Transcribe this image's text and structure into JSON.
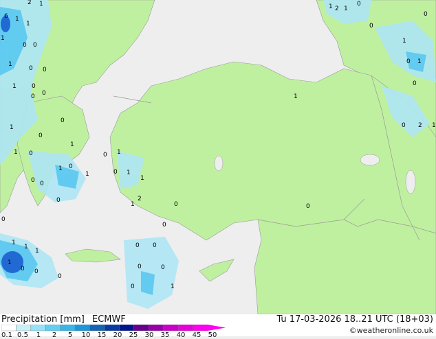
{
  "header": {
    "title": "Precipitation [mm]",
    "model": "ECMWF",
    "datetime": "Tu 17-03-2026 18..21 UTC (18+03)",
    "credit": "©weatheronline.co.uk"
  },
  "legend": {
    "ticks": [
      "0.1",
      "0.5",
      "1",
      "2",
      "5",
      "10",
      "15",
      "20",
      "25",
      "30",
      "35",
      "40",
      "45",
      "50"
    ],
    "colors": [
      "#ffffff",
      "#c8f0f8",
      "#96e1f5",
      "#64cdf0",
      "#3cb4e6",
      "#1e96d7",
      "#1464b4",
      "#0a3ca0",
      "#00148c",
      "#64008c",
      "#9600aa",
      "#c800c8",
      "#e600dc",
      "#ff00f0"
    ]
  },
  "colors": {
    "land": "#bff0a0",
    "sea": "#eeeeee",
    "border": "#888888",
    "precip_light": "#aee6f5",
    "precip_mid": "#5ac8f0",
    "precip_heavy": "#1e64d2"
  },
  "map_labels": [
    "2",
    "1",
    "1",
    "0",
    "2",
    "1",
    "6",
    "1",
    "0",
    "1",
    "1",
    "0",
    "0",
    "0",
    "1",
    "1",
    "0",
    "0",
    "1",
    "0",
    "0",
    "1",
    "0",
    "0",
    "0",
    "0",
    "1",
    "0",
    "2",
    "1",
    "0",
    "1",
    "1",
    "1",
    "0",
    "0",
    "1",
    "1",
    "0",
    "0",
    "0",
    "1",
    "0",
    "1",
    "1",
    "0",
    "2",
    "1",
    "0",
    "0",
    "0",
    "0",
    "0",
    "0",
    "0",
    "0",
    "0",
    "0",
    "0",
    "1",
    "1",
    "1",
    "1",
    "1",
    "0"
  ]
}
